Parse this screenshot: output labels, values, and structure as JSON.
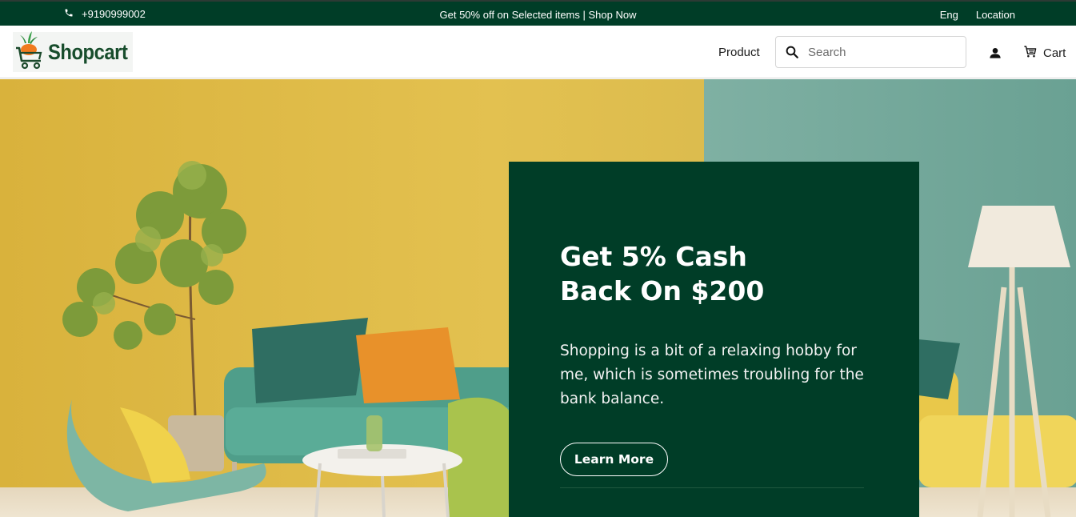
{
  "topbar": {
    "phone": "+9190999002",
    "promo": "Get 50% off on Selected items | Shop Now",
    "language": "Eng",
    "location": "Location",
    "phone_icon": "phone-icon"
  },
  "header": {
    "logo_text": "Shopcart",
    "nav_product": "Product",
    "search_placeholder": "Search",
    "cart_label": "Cart",
    "icons": [
      "search-icon",
      "user-icon",
      "cart-icon"
    ]
  },
  "hero": {
    "title_line1": "Get 5% Cash",
    "title_line2": "Back On $200",
    "description": "Shopping is a bit of a relaxing hobby for me, which is sometimes troubling for the bank balance.",
    "cta_label": "Learn More"
  },
  "colors": {
    "brand_green": "#003d27",
    "wall_yellow": "#e2bf4a",
    "wall_teal": "#79ab9e"
  }
}
